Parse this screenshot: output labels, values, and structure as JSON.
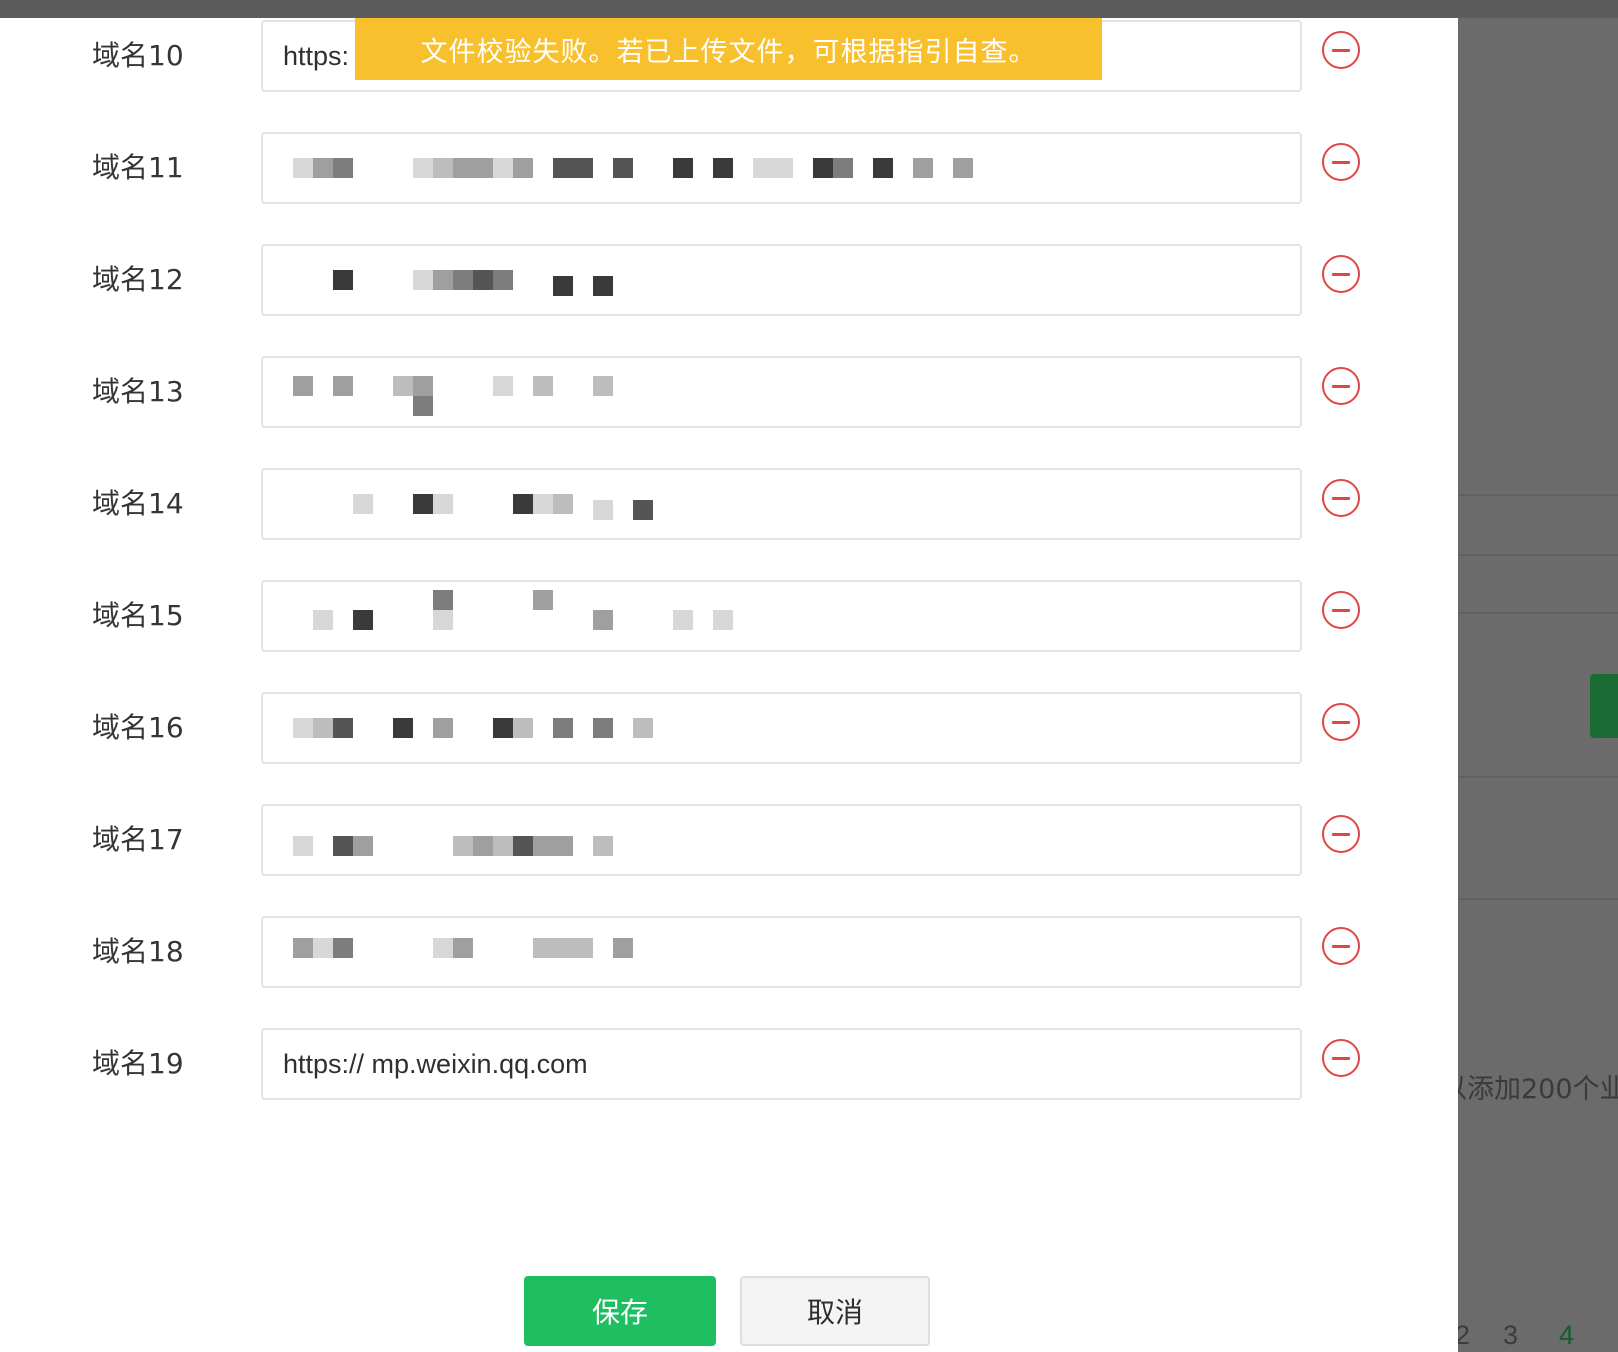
{
  "dialog": {
    "domains": [
      {
        "label": "域名10",
        "value": "https:",
        "masked": false
      },
      {
        "label": "域名11",
        "value": "",
        "masked": true
      },
      {
        "label": "域名12",
        "value": "",
        "masked": true
      },
      {
        "label": "域名13",
        "value": "",
        "masked": true
      },
      {
        "label": "域名14",
        "value": "",
        "masked": true
      },
      {
        "label": "域名15",
        "value": "",
        "masked": true
      },
      {
        "label": "域名16",
        "value": "",
        "masked": true
      },
      {
        "label": "域名17",
        "value": "",
        "masked": true
      },
      {
        "label": "域名18",
        "value": "",
        "masked": true
      },
      {
        "label": "域名19",
        "value": "https:// mp.weixin.qq.com",
        "masked": false
      }
    ],
    "toast": "文件校验失败。若已上传文件，可根据指引自查。",
    "save_label": "保存",
    "cancel_label": "取消"
  },
  "background": {
    "note": "以添加200个业",
    "pagination": [
      "2",
      "3",
      "4"
    ]
  },
  "colors": {
    "toast_bg": "#f9c02d",
    "primary": "#1fbe61",
    "danger": "#e04646"
  }
}
